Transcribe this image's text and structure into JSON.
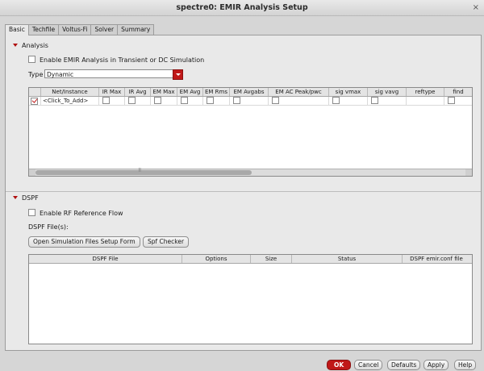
{
  "window": {
    "title": "spectre0: EMIR Analysis Setup",
    "close_glyph": "×"
  },
  "tabs": [
    "Basic",
    "Techfile",
    "Voltus-Fi",
    "Solver",
    "Summary"
  ],
  "analysis": {
    "section_label": "Analysis",
    "enable_label": "Enable EMIR Analysis in Transient or DC Simulation",
    "type_label": "Type",
    "type_value": "Dynamic",
    "columns": [
      "",
      "Net/Instance",
      "IR Max",
      "IR Avg",
      "EM Max",
      "EM Avg",
      "EM Rms",
      "EM Avgabs",
      "EM AC Peak/pwc",
      "sig vmax",
      "sig vavg",
      "reftype",
      "find"
    ],
    "row": {
      "net": "<Click_To_Add>"
    },
    "scroll_glyph": "⠿"
  },
  "dspf": {
    "section_label": "DSPF",
    "rf_label": "Enable RF Reference Flow",
    "files_label": "DSPF File(s):",
    "open_button": "Open Simulation Files Setup Form",
    "checker_button": "Spf Checker",
    "columns": [
      "DSPF File",
      "Options",
      "Size",
      "Status",
      "DSPF emir.conf file"
    ]
  },
  "footer": {
    "ok": "OK",
    "cancel": "Cancel",
    "defaults": "Defaults",
    "apply": "Apply",
    "help": "Help"
  },
  "colors": {
    "accent": "#c01818"
  }
}
